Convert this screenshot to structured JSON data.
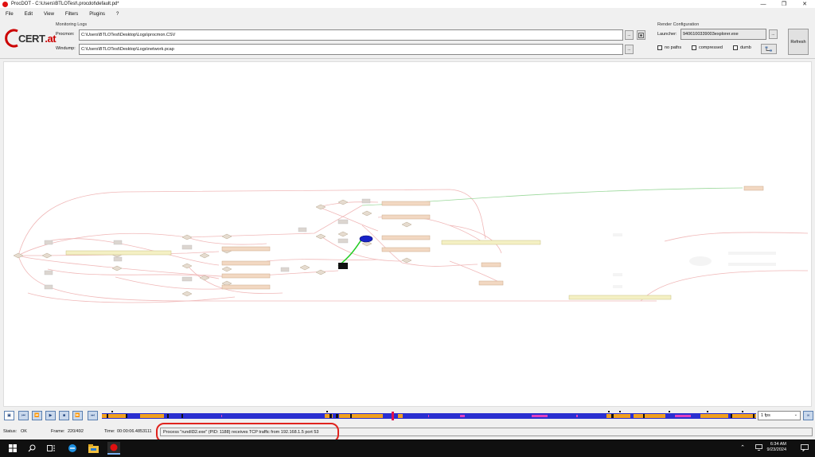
{
  "window": {
    "title": "ProcDOT - C:\\Users\\BTLOTest\\.procdot\\default.pd*"
  },
  "menu": [
    "File",
    "Edit",
    "View",
    "Filters",
    "Plugins",
    "?"
  ],
  "logo": {
    "text_a": "CERT",
    "text_b": ".at"
  },
  "monitoring": {
    "section_label": "Monitoring Logs",
    "procmon_label": "Procmon:",
    "procmon_value": "C:\\Users\\BTLOTest\\Desktop\\Logs\\procmon.CSV",
    "windump_label": "Windump:",
    "windump_value": "C:\\Users\\BTLOTest\\Desktop\\Logs\\network.pcap",
    "browse_label": "..."
  },
  "render": {
    "section_label": "Render Configuration",
    "launcher_label": "Launcher:",
    "launcher_value": "9406100339003explorer.exe",
    "no_paths_label": "no paths",
    "compressed_label": "compressed",
    "dumb_label": "dumb",
    "refresh_label": "Refresh"
  },
  "playback": {
    "fps_value": "1 fps"
  },
  "status": {
    "status_label": "Status:",
    "status_value": "OK",
    "frame_label": "Frame:",
    "frame_value": "220/492",
    "time_label": "Time:",
    "time_value": "00:00:06.4853111",
    "info_text": "Process \"rundll32.exe\" (PID: 1188) receives TCP traffic from 192.168.1.5 port 53"
  },
  "taskbar": {
    "time": "6:34 AM",
    "date": "9/23/2024"
  },
  "colors": {
    "accent": "#e0231d",
    "timeline_blue": "#2a2fd0",
    "timeline_orange": "#f0a020",
    "node_fill": "#f0dcc8"
  }
}
